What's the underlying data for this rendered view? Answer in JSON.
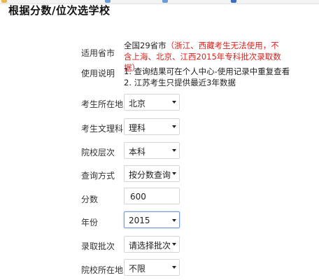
{
  "page": {
    "title": "根据分数/位次选学校"
  },
  "top_strip": {
    "items": [
      "...",
      "...",
      "...",
      "..."
    ]
  },
  "form": {
    "province_label": "适用省市",
    "province_value": "全国29省市",
    "province_note": "（浙江、西藏考生无法使用，不含上海、北京、江西2015年专科批次录取数据）",
    "instructions_label": "使用说明",
    "instructions": [
      "1. 查询结果可在个人中心-使用记录中重复查看",
      "2. 江苏考生只提供最近3年数据"
    ],
    "location_label": "考生所在地",
    "location_value": "北京",
    "track_label": "考生文理科",
    "track_value": "理科",
    "level_label": "院校层次",
    "level_value": "本科",
    "method_label": "查询方式",
    "method_value": "按分数查询",
    "score_label": "分数",
    "score_value": "600",
    "year_label": "年份",
    "year_value": "2015",
    "batch_label": "录取批次",
    "batch_value": "请选择批次",
    "school_location_label": "院校所在地",
    "school_location_value": "不限"
  }
}
